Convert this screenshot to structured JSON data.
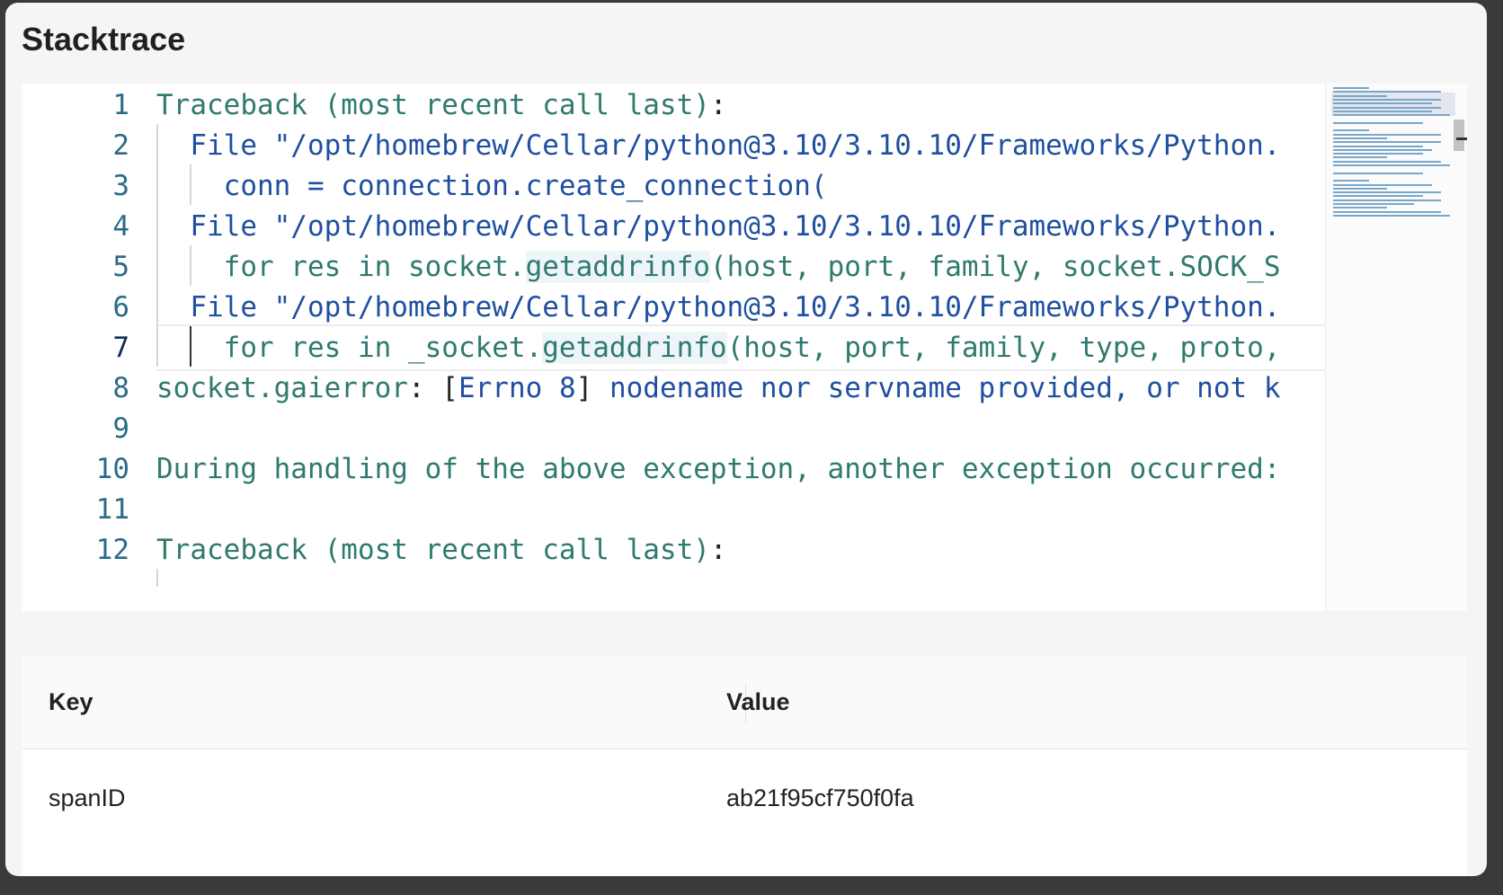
{
  "panel": {
    "title": "Stacktrace"
  },
  "editor": {
    "line_numbers": [
      "1",
      "2",
      "3",
      "4",
      "5",
      "6",
      "7",
      "8",
      "9",
      "10",
      "11",
      "12"
    ],
    "active_line": "7",
    "lines": [
      [
        {
          "t": "Traceback (most recent call last)",
          "c": "teal"
        },
        {
          "t": ":",
          "c": "dark"
        }
      ],
      [
        {
          "t": "  File \"/opt/homebrew/Cellar/python@3.10/3.10.10/Frameworks/Python.",
          "c": "blue"
        }
      ],
      [
        {
          "t": "    conn = connection.create_connection(",
          "c": "blue"
        }
      ],
      [
        {
          "t": "  File \"/opt/homebrew/Cellar/python@3.10/3.10.10/Frameworks/Python.",
          "c": "blue"
        }
      ],
      [
        {
          "t": "    for res in socket.",
          "c": "teal"
        },
        {
          "t": "getaddrinfo",
          "c": "teal",
          "hl": true
        },
        {
          "t": "(host, port, family, socket.SOCK_S",
          "c": "teal"
        }
      ],
      [
        {
          "t": "  File \"/opt/homebrew/Cellar/python@3.10/3.10.10/Frameworks/Python.",
          "c": "blue"
        }
      ],
      [
        {
          "t": "    for res in _socket.",
          "c": "teal"
        },
        {
          "t": "getaddrinfo",
          "c": "teal",
          "hl": true
        },
        {
          "t": "(host, port, family, type, proto,",
          "c": "teal"
        }
      ],
      [
        {
          "t": "socket.gaierror",
          "c": "teal"
        },
        {
          "t": ": [",
          "c": "dark"
        },
        {
          "t": "Errno 8",
          "c": "blue"
        },
        {
          "t": "] ",
          "c": "dark"
        },
        {
          "t": "nodename nor servname provided, or not k",
          "c": "blue"
        }
      ],
      [],
      [
        {
          "t": "During handling of the above exception, another exception occurred:",
          "c": "teal"
        }
      ],
      [],
      [
        {
          "t": "Traceback (most recent call last)",
          "c": "teal"
        },
        {
          "t": ":",
          "c": "dark"
        }
      ]
    ]
  },
  "table": {
    "headers": {
      "key": "Key",
      "value": "Value"
    },
    "rows": [
      {
        "key": "spanID",
        "value": "ab21f95cf750f0fa"
      }
    ]
  }
}
